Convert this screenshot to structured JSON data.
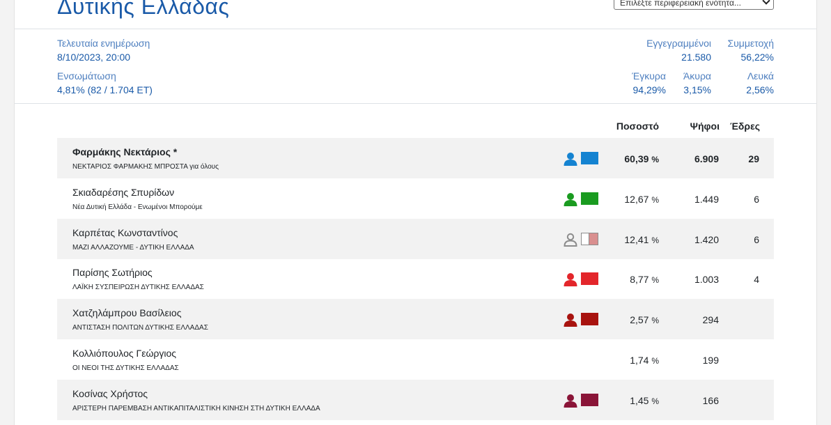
{
  "header": {
    "title": "Δυτικής Ελλάδας",
    "region_select": "Επιλέξτε περιφερειακή ενότητα..."
  },
  "meta": {
    "last_update_label": "Τελευταία ενημέρωση",
    "last_update_value": "8/10/2023, 20:00",
    "integration_label": "Ενσωμάτωση",
    "integration_value": "4,81% (82 / 1.704 ΕΤ)",
    "registered_label": "Εγγεγραμμένοι",
    "registered_value": "21.580",
    "turnout_label": "Συμμετοχή",
    "turnout_value": "56,22%",
    "valid_label": "Έγκυρα",
    "valid_value": "94,29%",
    "invalid_label": "Άκυρα",
    "invalid_value": "3,15%",
    "blank_label": "Λευκά",
    "blank_value": "2,56%"
  },
  "table": {
    "headers": {
      "percent": "Ποσοστό",
      "votes": "Ψήφοι",
      "seats": "Έδρες"
    },
    "pct_unit": "%",
    "rows": [
      {
        "name": "Φαρμάκης Νεκτάριος *",
        "party": "ΝΕΚΤΑΡΙΟΣ ΦΑΡΜΑΚΗΣ ΜΠΡΟΣΤΑ για όλους",
        "percent": "60,39",
        "votes": "6.909",
        "seats": "29",
        "person_color": "#1583d1",
        "swatch_color": "#1583d1",
        "swatch_color2": "#1583d1"
      },
      {
        "name": "Σκιαδαρέσης Σπυρίδων",
        "party": "Νέα Δυτική Ελλάδα - Ενωμένοι Μπορούμε",
        "percent": "12,67",
        "votes": "1.449",
        "seats": "6",
        "person_color": "#1a9b20",
        "swatch_color": "#1a9b20",
        "swatch_color2": "#1a9b20"
      },
      {
        "name": "Καρπέτας Κωνσταντίνος",
        "party": "ΜΑΖΙ ΑΛΛΑΖΟΥΜΕ - ΔΥΤΙΚΗ ΕΛΛΑΔΑ",
        "percent": "12,41",
        "votes": "1.420",
        "seats": "6",
        "person_color": "#8c8c8c",
        "swatch_color": "#ffffff",
        "swatch_color2": "#d98f8f"
      },
      {
        "name": "Παρίσης Σωτήριος",
        "party": "ΛΑΪΚΗ ΣΥΣΠΕΙΡΩΣΗ ΔΥΤΙΚΗΣ ΕΛΛΑΔΑΣ",
        "percent": "8,77",
        "votes": "1.003",
        "seats": "4",
        "person_color": "#e3262b",
        "swatch_color": "#e3262b",
        "swatch_color2": "#e3262b"
      },
      {
        "name": "Χατζηλάμπρου Βασίλειος",
        "party": "ΑΝΤΙΣΤΑΣΗ ΠΟΛΙΤΩΝ ΔΥΤΙΚΗΣ ΕΛΛΑΔΑΣ",
        "percent": "2,57",
        "votes": "294",
        "seats": "",
        "person_color": "#a8130f",
        "swatch_color": "#a8130f",
        "swatch_color2": "#a8130f"
      },
      {
        "name": "Κολλιόπουλος Γεώργιος",
        "party": "ΟΙ ΝΕΟΙ ΤΗΣ ΔΥΤΙΚΗΣ ΕΛΛΑΔΑΣ",
        "percent": "1,74",
        "votes": "199",
        "seats": "",
        "person_color": "",
        "swatch_color": "",
        "swatch_color2": ""
      },
      {
        "name": "Κοσίνας Χρήστος",
        "party": "ΑΡΙΣΤΕΡΗ ΠΑΡΕΜΒΑΣΗ ΑΝΤΙΚΑΠΙΤΑΛΙΣΤΙΚΗ ΚΙΝΗΣΗ ΣΤΗ ΔΥΤΙΚΗ ΕΛΛΑΔΑ",
        "percent": "1,45",
        "votes": "166",
        "seats": "",
        "person_color": "#8a1538",
        "swatch_color": "#8a1538",
        "swatch_color2": "#8a1538"
      }
    ]
  }
}
